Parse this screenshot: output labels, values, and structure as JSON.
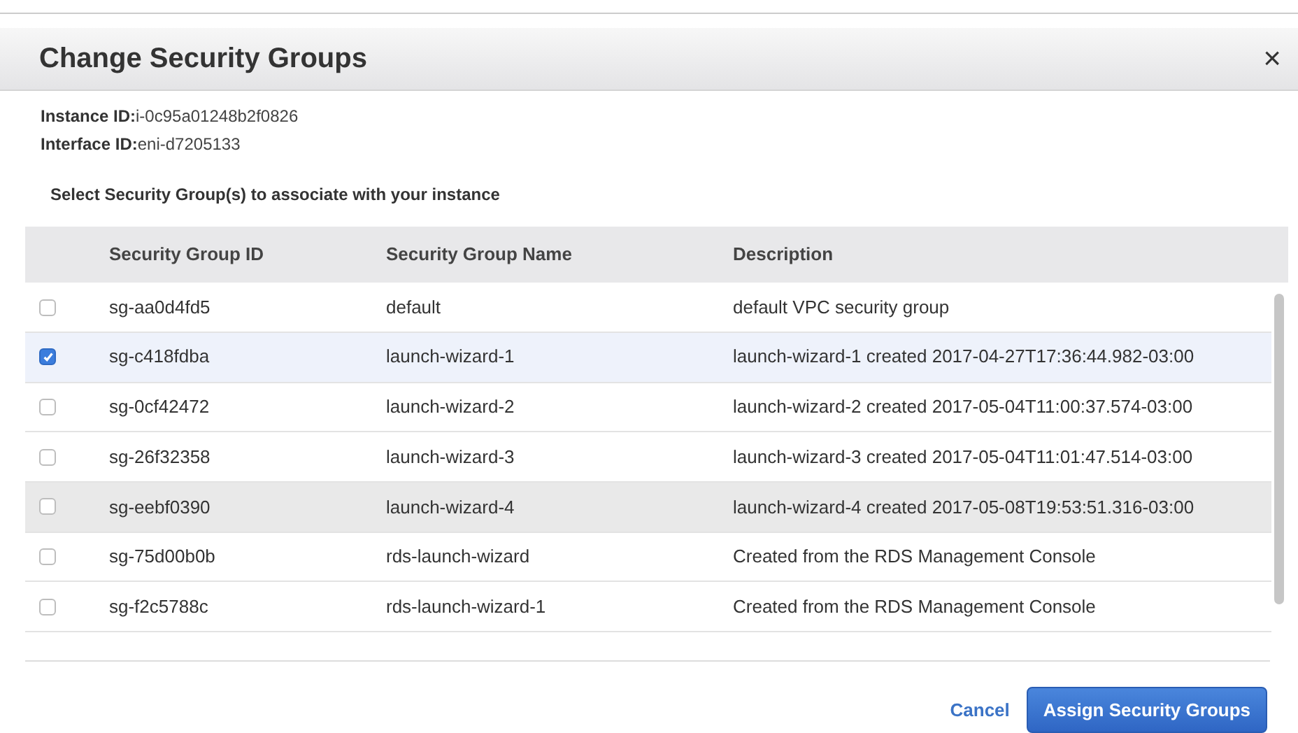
{
  "dialog": {
    "title": "Change Security Groups",
    "close": "×"
  },
  "info": [
    {
      "label": "Instance ID:",
      "value": "i-0c95a01248b2f0826"
    },
    {
      "label": "Interface ID:",
      "value": "eni-d7205133"
    }
  ],
  "instruction": "Select Security Group(s) to associate with your instance",
  "table": {
    "columns": [
      "Security Group ID",
      "Security Group Name",
      "Description"
    ],
    "rows": [
      {
        "id": "sg-aa0d4fd5",
        "name": "default",
        "description": "default VPC security group",
        "selected": false,
        "hovered": false
      },
      {
        "id": "sg-c418fdba",
        "name": "launch-wizard-1",
        "description": "launch-wizard-1 created 2017-04-27T17:36:44.982-03:00",
        "selected": true,
        "hovered": false
      },
      {
        "id": "sg-0cf42472",
        "name": "launch-wizard-2",
        "description": "launch-wizard-2 created 2017-05-04T11:00:37.574-03:00",
        "selected": false,
        "hovered": false
      },
      {
        "id": "sg-26f32358",
        "name": "launch-wizard-3",
        "description": "launch-wizard-3 created 2017-05-04T11:01:47.514-03:00",
        "selected": false,
        "hovered": false
      },
      {
        "id": "sg-eebf0390",
        "name": "launch-wizard-4",
        "description": "launch-wizard-4 created 2017-05-08T19:53:51.316-03:00",
        "selected": false,
        "hovered": true
      },
      {
        "id": "sg-75d00b0b",
        "name": "rds-launch-wizard",
        "description": "Created from the RDS Management Console",
        "selected": false,
        "hovered": false
      },
      {
        "id": "sg-f2c5788c",
        "name": "rds-launch-wizard-1",
        "description": "Created from the RDS Management Console",
        "selected": false,
        "hovered": false
      }
    ]
  },
  "buttons": {
    "cancel": "Cancel",
    "primary": "Assign Security Groups"
  }
}
